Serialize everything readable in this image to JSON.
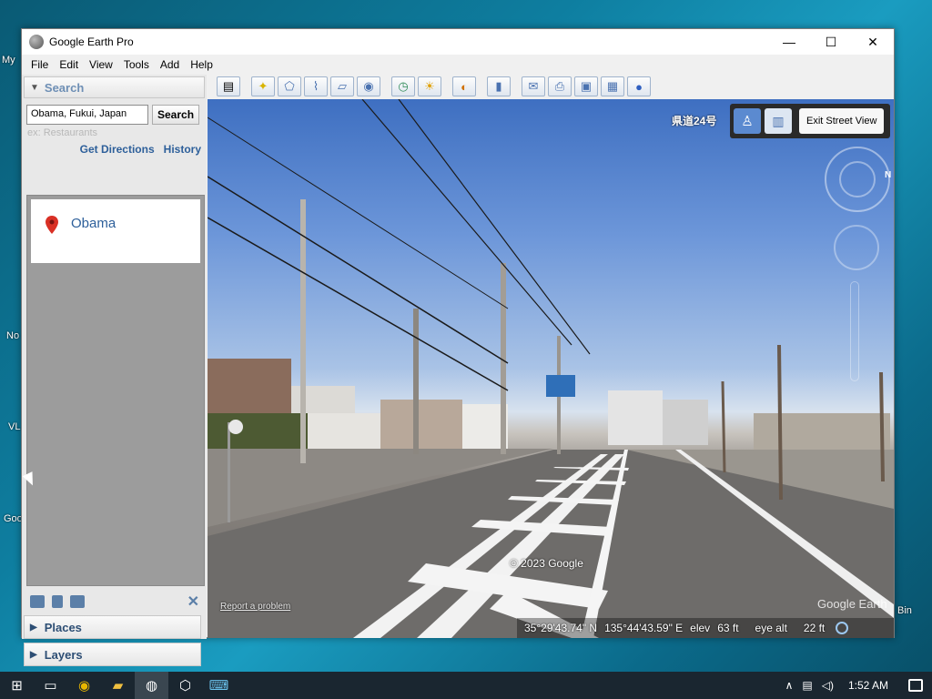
{
  "desktop": {
    "label_my": "My",
    "label_no": "No",
    "label_vl": "VL",
    "label_goo": "Goo",
    "label_bin": "Bin"
  },
  "window": {
    "title": "Google Earth Pro"
  },
  "window_controls": {
    "minimize": "—",
    "maximize": "☐",
    "close": "✕"
  },
  "menu": [
    "File",
    "Edit",
    "View",
    "Tools",
    "Add",
    "Help"
  ],
  "search_panel": {
    "header": "Search",
    "input_value": "Obama, Fukui, Japan",
    "search_button": "Search",
    "hint": "ex: Restaurants",
    "get_directions": "Get Directions",
    "history": "History",
    "results": [
      {
        "name": "Obama"
      }
    ]
  },
  "places": {
    "header": "Places"
  },
  "layers": {
    "header": "Layers"
  },
  "streetview": {
    "road_name": "県道24号",
    "exit_button": "Exit Street View",
    "compass_n": "N",
    "copyright": "© 2023 Google",
    "report": "Report a problem",
    "watermark": "Google Earth"
  },
  "status": {
    "lat": "35°29'43.74\" N",
    "lon": "135°44'43.59\" E",
    "elev_label": "elev",
    "elev_value": "63 ft",
    "eye_label": "eye alt",
    "eye_value": "22 ft"
  },
  "taskbar": {
    "time": "1:52 AM"
  },
  "colors": {
    "link": "#2d5f9a",
    "pin": "#d93025",
    "taskbar": "#1a2630"
  }
}
